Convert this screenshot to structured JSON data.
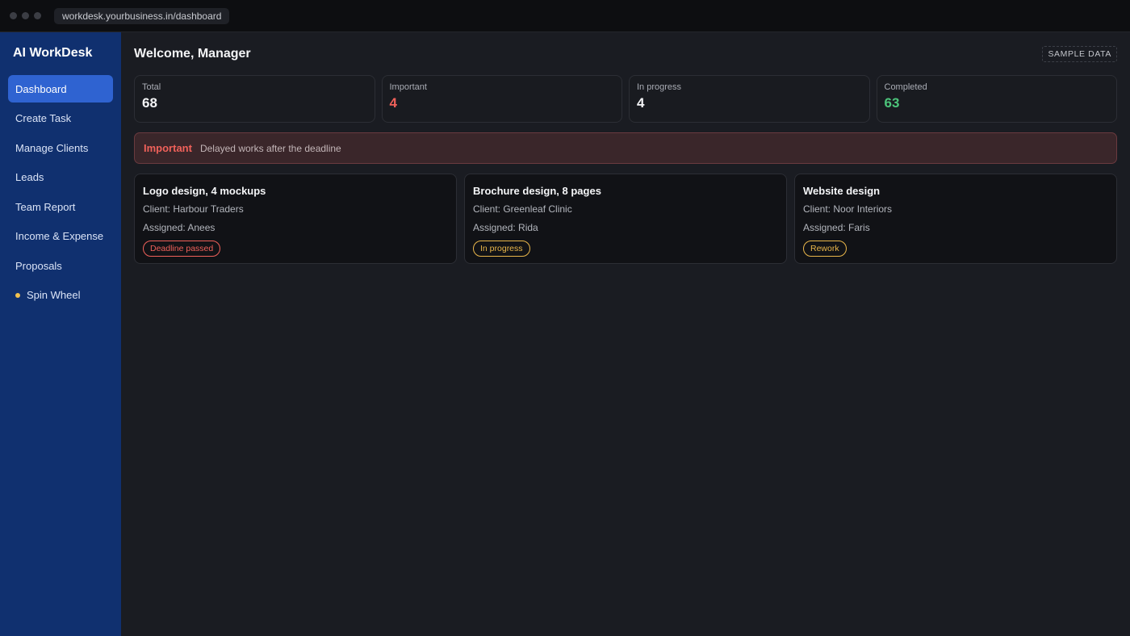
{
  "browser": {
    "url": "workdesk.yourbusiness.in/dashboard"
  },
  "sidebar": {
    "brand": "AI WorkDesk",
    "items": [
      {
        "label": "Dashboard",
        "active": true
      },
      {
        "label": "Create Task"
      },
      {
        "label": "Manage Clients"
      },
      {
        "label": "Leads"
      },
      {
        "label": "Team Report"
      },
      {
        "label": "Income & Expense"
      },
      {
        "label": "Proposals"
      },
      {
        "label": "Spin Wheel",
        "bullet_color": "#f2c14e"
      }
    ]
  },
  "header": {
    "title": "Welcome, Manager",
    "badge": "SAMPLE DATA"
  },
  "stats": [
    {
      "label": "Total",
      "value": "68",
      "color": "#f4f5f7"
    },
    {
      "label": "Important",
      "value": "4",
      "color": "#f0615a"
    },
    {
      "label": "In progress",
      "value": "4",
      "color": "#f4f5f7"
    },
    {
      "label": "Completed",
      "value": "63",
      "color": "#4cc47a"
    }
  ],
  "alert": {
    "title": "Important",
    "text": "Delayed works after the deadline"
  },
  "tasks": [
    {
      "title": "Logo design, 4 mockups",
      "client": "Client: Harbour Traders",
      "assigned": "Assigned: Anees",
      "status": "Deadline passed",
      "status_color": "#f0615a"
    },
    {
      "title": "Brochure design, 8 pages",
      "client": "Client: Greenleaf Clinic",
      "assigned": "Assigned: Rida",
      "status": "In progress",
      "status_color": "#e9b64a"
    },
    {
      "title": "Website design",
      "client": "Client: Noor Interiors",
      "assigned": "Assigned: Faris",
      "status": "Rework",
      "status_color": "#e9b64a"
    }
  ]
}
